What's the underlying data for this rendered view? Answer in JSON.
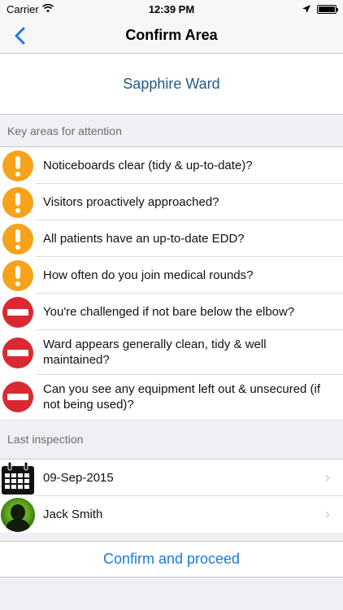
{
  "status_bar": {
    "carrier": "Carrier",
    "time": "12:39 PM"
  },
  "nav": {
    "title": "Confirm Area"
  },
  "ward": {
    "name": "Sapphire Ward"
  },
  "key_areas": {
    "header": "Key areas for attention",
    "items": [
      {
        "label": "Noticeboards clear (tidy & up-to-date)?",
        "severity": "warning",
        "icon": "exclamation-icon"
      },
      {
        "label": "Visitors proactively approached?",
        "severity": "warning",
        "icon": "exclamation-icon"
      },
      {
        "label": "All patients have an up-to-date EDD?",
        "severity": "warning",
        "icon": "exclamation-icon"
      },
      {
        "label": "How often do you join medical rounds?",
        "severity": "warning",
        "icon": "exclamation-icon"
      },
      {
        "label": "You're challenged if not bare below the elbow?",
        "severity": "critical",
        "icon": "no-entry-icon"
      },
      {
        "label": "Ward appears generally clean, tidy & well maintained?",
        "severity": "critical",
        "icon": "no-entry-icon"
      },
      {
        "label": "Can you see any equipment left out & unsecured (if not being used)?",
        "severity": "critical",
        "icon": "no-entry-icon"
      }
    ]
  },
  "last_inspection": {
    "header": "Last inspection",
    "date": "09-Sep-2015",
    "inspector": "Jack Smith"
  },
  "confirm": {
    "label": "Confirm and proceed"
  },
  "colors": {
    "warning": "#f7a21b",
    "critical": "#d92a32",
    "accent": "#1a7be0",
    "ward": "#235a8c"
  }
}
